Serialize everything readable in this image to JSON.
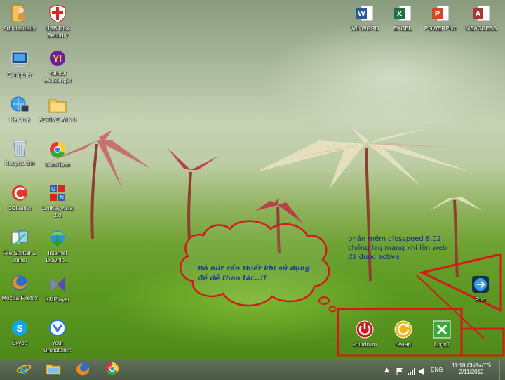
{
  "desktop": {
    "icons_left": [
      {
        "label": "Administrator",
        "icon": "user-folder-icon"
      },
      {
        "label": "USB Disk\nSecurity",
        "icon": "usb-disk-security-icon"
      },
      {
        "label": "Computer",
        "icon": "computer-icon"
      },
      {
        "label": "Yahoo!\nMessenger",
        "icon": "yahoo-messenger-icon"
      },
      {
        "label": "Network",
        "icon": "network-icon"
      },
      {
        "label": "ACTIVE WIN 8",
        "icon": "folder-icon"
      },
      {
        "label": "Recycle Bin",
        "icon": "recycle-bin-icon"
      },
      {
        "label": "CoolNovo",
        "icon": "coolnovo-icon"
      },
      {
        "label": "CCleaner",
        "icon": "ccleaner-icon"
      },
      {
        "label": "UniKeyVista\n2.0",
        "icon": "unikey-icon"
      },
      {
        "label": "File Splitter &\nJoiner",
        "icon": "file-splitter-icon"
      },
      {
        "label": "Internet\nDownlo...",
        "icon": "internet-download-icon"
      },
      {
        "label": "Mozilla\nFirefox",
        "icon": "firefox-icon"
      },
      {
        "label": "KMPlayer",
        "icon": "kmplayer-icon"
      },
      {
        "label": "Skype",
        "icon": "skype-icon"
      },
      {
        "label": "Your\nUninstaller!",
        "icon": "uninstaller-icon"
      }
    ],
    "icons_top_right": [
      {
        "label": "WINWORD",
        "icon": "word-icon",
        "color": "#2b5797"
      },
      {
        "label": "EXCEL",
        "icon": "excel-icon",
        "color": "#1e7145"
      },
      {
        "label": "POWERPNT",
        "icon": "powerpoint-icon",
        "color": "#d24726"
      },
      {
        "label": "MSACCESS",
        "icon": "access-icon",
        "color": "#a4373a"
      }
    ],
    "icons_bottom_right": [
      {
        "label": "Run",
        "icon": "run-icon"
      },
      {
        "label": "shutdown",
        "icon": "shutdown-icon"
      },
      {
        "label": "restart",
        "icon": "restart-icon"
      },
      {
        "label": "Logoff",
        "icon": "logoff-icon"
      }
    ],
    "annotations": {
      "bubble_text": "Bô nút cần thiết khi sử dụng để dễ thao tác..!!",
      "note_text": "phần mềm cfosspeed 8.02 chống lag mạng khi lên web đã được active",
      "highlight_color": "#d81818"
    }
  },
  "taskbar": {
    "pinned": [
      {
        "name": "internet-explorer-icon"
      },
      {
        "name": "file-explorer-icon"
      },
      {
        "name": "firefox-icon"
      },
      {
        "name": "coolnovo-icon"
      }
    ],
    "language": "ENG",
    "time": "11:18 Chiều/Tối",
    "date": "2/11/2012"
  }
}
